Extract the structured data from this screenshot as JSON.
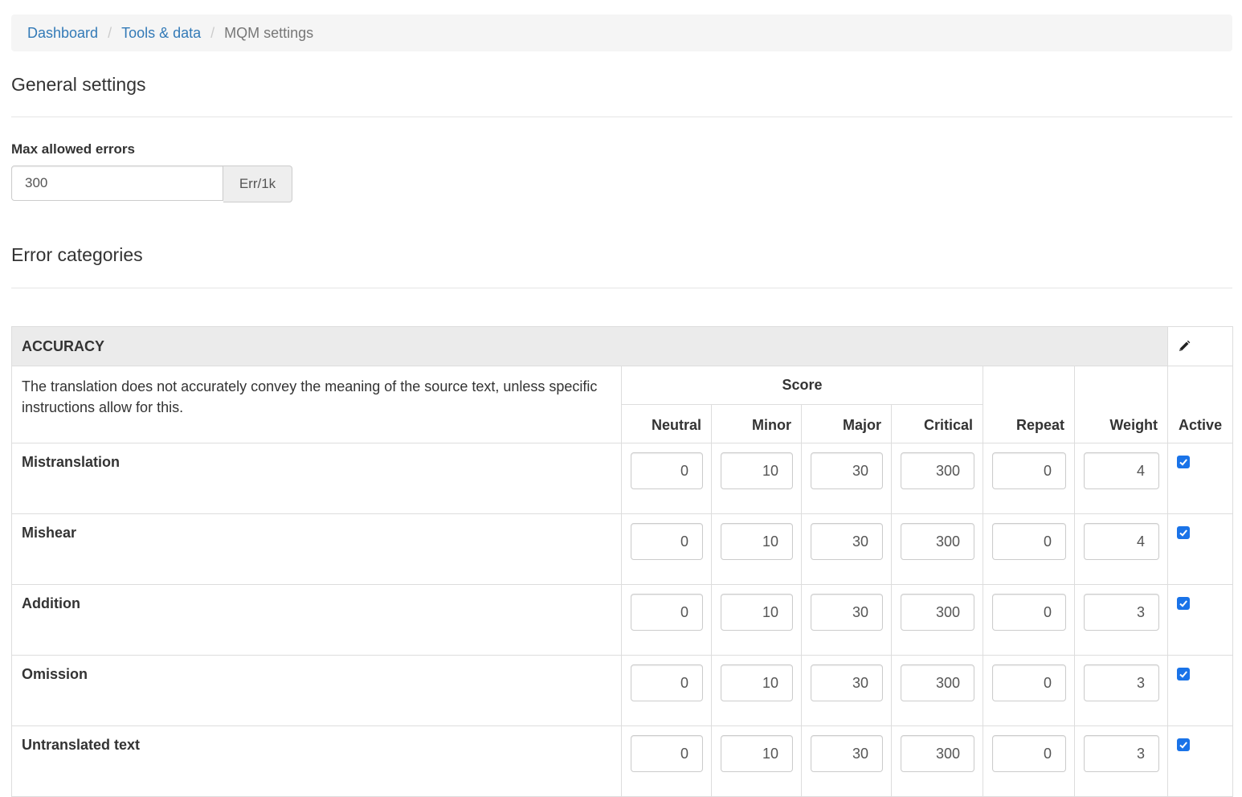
{
  "breadcrumb": {
    "items": [
      "Dashboard",
      "Tools & data"
    ],
    "current": "MQM settings",
    "separator": "/"
  },
  "general": {
    "title": "General settings",
    "max_errors_label": "Max allowed errors",
    "max_errors_value": "300",
    "unit": "Err/1k"
  },
  "error_categories": {
    "title": "Error categories",
    "category": {
      "name": "ACCURACY",
      "description": "The translation does not accurately convey the meaning of the source text, unless specific instructions allow for this.",
      "columns": {
        "score": "Score",
        "neutral": "Neutral",
        "minor": "Minor",
        "major": "Major",
        "critical": "Critical",
        "repeat": "Repeat",
        "weight": "Weight",
        "active": "Active"
      },
      "rows": [
        {
          "name": "Mistranslation",
          "neutral": "0",
          "minor": "10",
          "major": "30",
          "critical": "300",
          "repeat": "0",
          "weight": "4",
          "active": true
        },
        {
          "name": "Mishear",
          "neutral": "0",
          "minor": "10",
          "major": "30",
          "critical": "300",
          "repeat": "0",
          "weight": "4",
          "active": true
        },
        {
          "name": "Addition",
          "neutral": "0",
          "minor": "10",
          "major": "30",
          "critical": "300",
          "repeat": "0",
          "weight": "3",
          "active": true
        },
        {
          "name": "Omission",
          "neutral": "0",
          "minor": "10",
          "major": "30",
          "critical": "300",
          "repeat": "0",
          "weight": "3",
          "active": true
        },
        {
          "name": "Untranslated text",
          "neutral": "0",
          "minor": "10",
          "major": "30",
          "critical": "300",
          "repeat": "0",
          "weight": "3",
          "active": true
        }
      ]
    }
  },
  "colors": {
    "link": "#337ab7",
    "checkbox": "#1a73e8",
    "header_bg": "#ebebeb"
  },
  "icons": {
    "edit": "pencil-icon",
    "check": "checkmark-icon"
  }
}
